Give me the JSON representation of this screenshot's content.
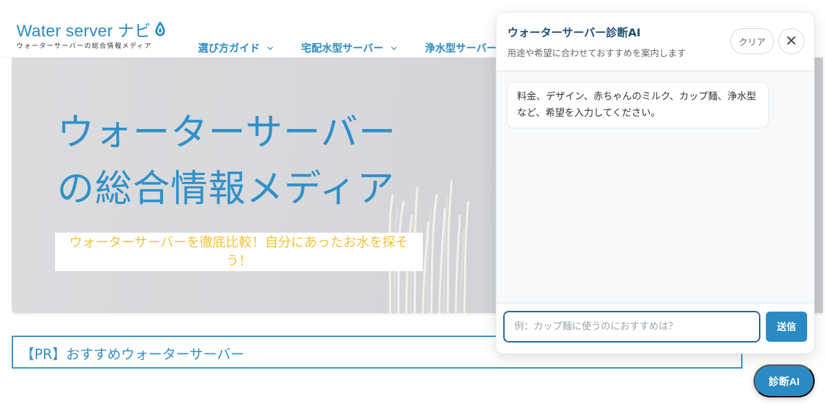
{
  "site": {
    "logo_text": "Water server ナビ",
    "logo_subtitle": "ウォーターサーバーの総合情報メディア"
  },
  "nav": {
    "items": [
      {
        "label": "選び方ガイド"
      },
      {
        "label": "宅配水型サーバー"
      },
      {
        "label": "浄水型サーバー"
      }
    ]
  },
  "hero": {
    "title_line1": "ウォーターサーバー",
    "title_line2": "の総合情報メディア",
    "subtitle": "ウォーターサーバーを徹底比較！自分にあったお水を探そう！"
  },
  "pr_section": {
    "title": "【PR】おすすめウォーターサーバー"
  },
  "chat": {
    "title": "ウォーターサーバー診断AI",
    "subtitle": "用途や希望に合わせておすすめを案内します",
    "clear_label": "クリア",
    "messages": [
      {
        "role": "assistant",
        "text": "料金、デザイン、赤ちゃんのミルク、カップ麺、浄水型など、希望を入力してください。"
      }
    ],
    "input_value": "",
    "input_placeholder": "例：カップ麺に使うのにおすすめは？",
    "send_label": "送信"
  },
  "fab": {
    "label": "診断AI"
  },
  "colors": {
    "brand": "#2b8ac4",
    "hero_title": "#3190c8",
    "hero_subtitle": "#f0c33c",
    "chat_title": "#1f4f72",
    "input_focus": "#1f5fa8"
  },
  "icons": {
    "logo": "water-drop-icon",
    "nav_dropdown": "chevron-down-icon",
    "close": "close-icon"
  }
}
